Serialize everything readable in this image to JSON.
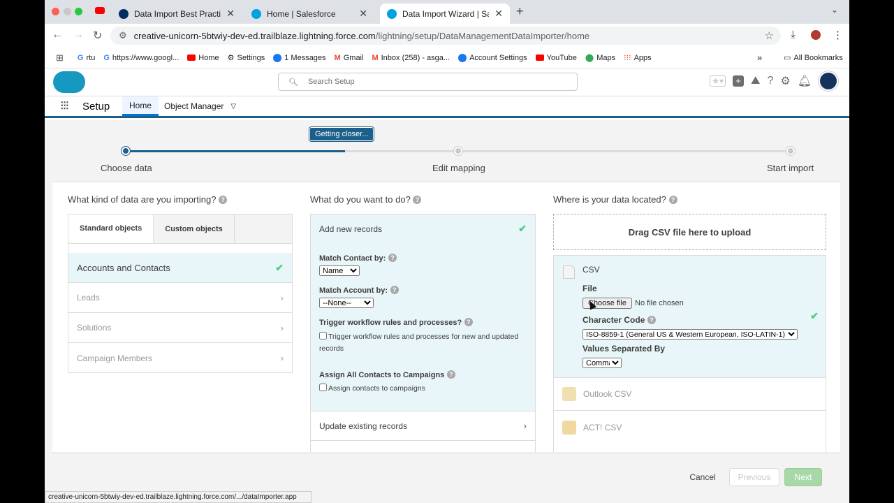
{
  "browser": {
    "tabs": [
      {
        "title": "Data Import Best Practices"
      },
      {
        "title": "Home | Salesforce"
      },
      {
        "title": "Data Import Wizard | Salesforce"
      }
    ],
    "url_host": "creative-unicorn-5btwiy-dev-ed.trailblaze.lightning.force.com",
    "url_path": "/lightning/setup/DataManagementDataImporter/home",
    "bookmarks": [
      "rtu",
      "https://www.googl...",
      "Home",
      "Settings",
      "1 Messages",
      "Gmail",
      "Inbox (258) - asga...",
      "Account Settings",
      "YouTube",
      "Maps",
      "Apps"
    ],
    "all_bookmarks": "All Bookmarks",
    "status_url": "creative-unicorn-5btwiy-dev-ed.trailblaze.lightning.force.com/.../dataImporter.app"
  },
  "sf": {
    "search_placeholder": "Search Setup",
    "app_name": "Setup",
    "nav_tabs": [
      "Home",
      "Object Manager"
    ]
  },
  "progress": {
    "tooltip": "Getting closer...",
    "steps": [
      "Choose data",
      "Edit mapping",
      "Start import"
    ],
    "fraction": 0.33
  },
  "col1": {
    "heading": "What kind of data are you importing?",
    "tabs": [
      "Standard objects",
      "Custom objects"
    ],
    "objects": [
      "Accounts and Contacts",
      "Leads",
      "Solutions",
      "Campaign Members"
    ]
  },
  "col2": {
    "heading": "What do you want to do?",
    "add_new": "Add new records",
    "match_contact_label": "Match Contact by:",
    "match_contact_value": "Name",
    "match_account_label": "Match Account by:",
    "match_account_value": "--None--",
    "trigger_label": "Trigger workflow rules and processes?",
    "trigger_checkbox": "Trigger workflow rules and processes for new and updated records",
    "assign_label": "Assign All Contacts to Campaigns",
    "assign_checkbox": "Assign contacts to campaigns",
    "update_existing": "Update existing records"
  },
  "col3": {
    "heading": "Where is your data located?",
    "drag_text": "Drag CSV file here to upload",
    "csv_title": "CSV",
    "file_label": "File",
    "choose_file": "Choose file",
    "no_file": "No file chosen",
    "charset_label": "Character Code",
    "charset_value": "ISO-8859-1 (General US & Western European, ISO-LATIN-1)",
    "separator_label": "Values Separated By",
    "separator_value": "Comma",
    "other_sources": [
      "Outlook CSV",
      "ACT! CSV"
    ]
  },
  "footer": {
    "cancel": "Cancel",
    "previous": "Previous",
    "next": "Next"
  }
}
